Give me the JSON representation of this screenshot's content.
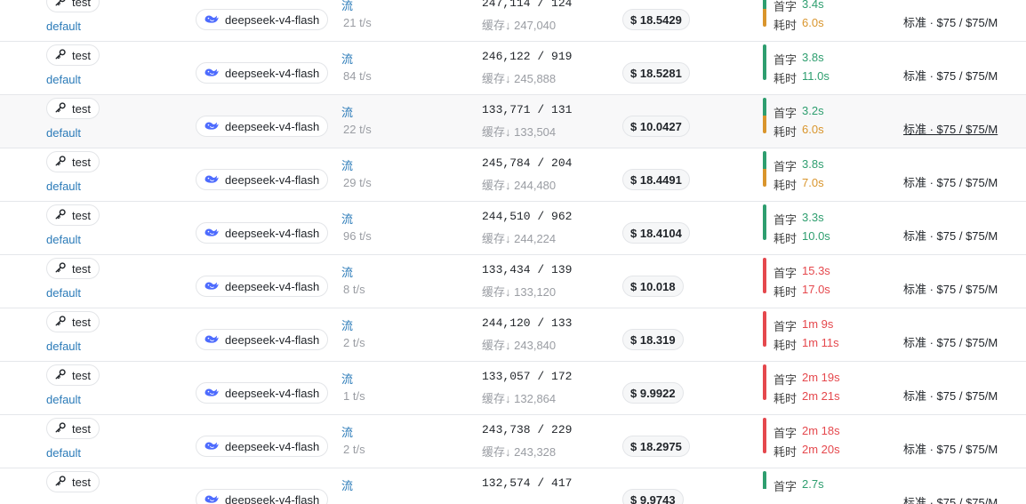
{
  "labels": {
    "stream": "流",
    "cache_prefix": "缓存↓",
    "first_token": "首字",
    "duration": "耗时"
  },
  "colors": {
    "green": "#2e9e6f",
    "orange": "#d9952c",
    "red": "#e5484d",
    "link": "#2a7ab8"
  },
  "rows": [
    {
      "token": "test",
      "group": "default",
      "model": "deepseek-v4-flash",
      "tps": "21 t/s",
      "tokens": "247,114 / 124",
      "cache": "247,040",
      "cost": "$ 18.5429",
      "first": "3.4s",
      "first_color": "green",
      "dur": "6.0s",
      "dur_color": "orange",
      "price": "标准 · $75 / $75/M"
    },
    {
      "token": "test",
      "group": "default",
      "model": "deepseek-v4-flash",
      "tps": "84 t/s",
      "tokens": "246,122 / 919",
      "cache": "245,888",
      "cost": "$ 18.5281",
      "first": "3.8s",
      "first_color": "green",
      "dur": "11.0s",
      "dur_color": "green",
      "price": "标准 · $75 / $75/M"
    },
    {
      "token": "test",
      "group": "default",
      "model": "deepseek-v4-flash",
      "tps": "22 t/s",
      "tokens": "133,771 / 131",
      "cache": "133,504",
      "cost": "$ 10.0427",
      "first": "3.2s",
      "first_color": "green",
      "dur": "6.0s",
      "dur_color": "orange",
      "price": "标准 · $75 / $75/M",
      "hover": true
    },
    {
      "token": "test",
      "group": "default",
      "model": "deepseek-v4-flash",
      "tps": "29 t/s",
      "tokens": "245,784 / 204",
      "cache": "244,480",
      "cost": "$ 18.4491",
      "first": "3.8s",
      "first_color": "green",
      "dur": "7.0s",
      "dur_color": "orange",
      "price": "标准 · $75 / $75/M"
    },
    {
      "token": "test",
      "group": "default",
      "model": "deepseek-v4-flash",
      "tps": "96 t/s",
      "tokens": "244,510 / 962",
      "cache": "244,224",
      "cost": "$ 18.4104",
      "first": "3.3s",
      "first_color": "green",
      "dur": "10.0s",
      "dur_color": "green",
      "price": "标准 · $75 / $75/M"
    },
    {
      "token": "test",
      "group": "default",
      "model": "deepseek-v4-flash",
      "tps": "8 t/s",
      "tokens": "133,434 / 139",
      "cache": "133,120",
      "cost": "$ 10.018",
      "first": "15.3s",
      "first_color": "red",
      "dur": "17.0s",
      "dur_color": "red",
      "price": "标准 · $75 / $75/M"
    },
    {
      "token": "test",
      "group": "default",
      "model": "deepseek-v4-flash",
      "tps": "2 t/s",
      "tokens": "244,120 / 133",
      "cache": "243,840",
      "cost": "$ 18.319",
      "first": "1m 9s",
      "first_color": "red",
      "dur": "1m 11s",
      "dur_color": "red",
      "price": "标准 · $75 / $75/M"
    },
    {
      "token": "test",
      "group": "default",
      "model": "deepseek-v4-flash",
      "tps": "1 t/s",
      "tokens": "133,057 / 172",
      "cache": "132,864",
      "cost": "$ 9.9922",
      "first": "2m 19s",
      "first_color": "red",
      "dur": "2m 21s",
      "dur_color": "red",
      "price": "标准 · $75 / $75/M"
    },
    {
      "token": "test",
      "group": "default",
      "model": "deepseek-v4-flash",
      "tps": "2 t/s",
      "tokens": "243,738 / 229",
      "cache": "243,328",
      "cost": "$ 18.2975",
      "first": "2m 18s",
      "first_color": "red",
      "dur": "2m 20s",
      "dur_color": "red",
      "price": "标准 · $75 / $75/M"
    },
    {
      "token": "test",
      "group": "",
      "model": "deepseek-v4-flash",
      "tps": "",
      "tokens": "132,574 / 417",
      "cache": "",
      "cost": "$ 9.9743",
      "first": "2.7s",
      "first_color": "green",
      "dur": "",
      "dur_color": "green",
      "price": "标准 · $75 / $75/M"
    }
  ]
}
